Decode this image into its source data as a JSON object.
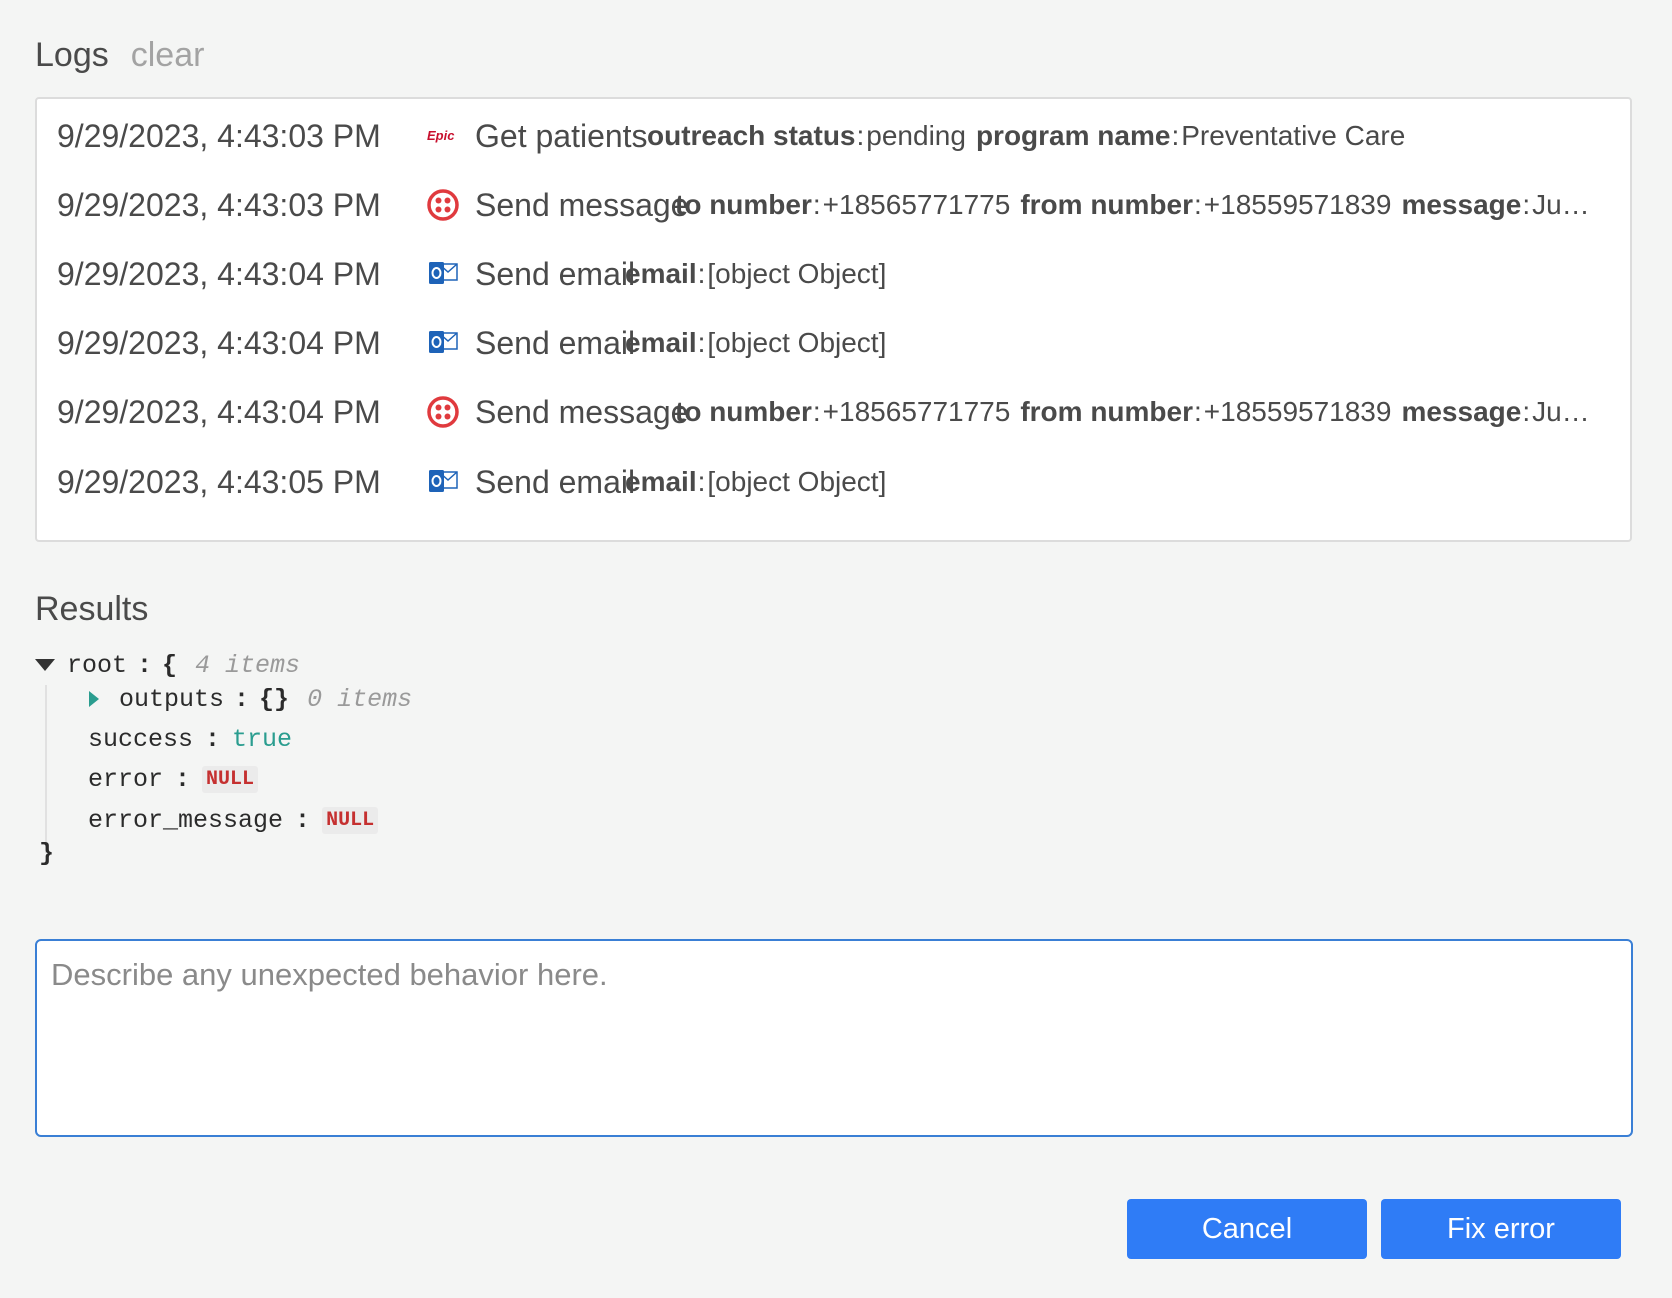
{
  "logs": {
    "title": "Logs",
    "clear_label": "clear",
    "rows": [
      {
        "time": "9/29/2023, 4:43:03 PM",
        "icon": "epic-icon",
        "action": "Get patients",
        "params": [
          {
            "key": "outreach status",
            "value": "pending"
          },
          {
            "key": "program name",
            "value": "Preventative Care"
          }
        ]
      },
      {
        "time": "9/29/2023, 4:43:03 PM",
        "icon": "twilio-icon",
        "action": "Send message",
        "params": [
          {
            "key": "to number",
            "value": "+18565771775"
          },
          {
            "key": "from number",
            "value": "+18559571839"
          },
          {
            "key": "message",
            "value": "Ju…"
          }
        ]
      },
      {
        "time": "9/29/2023, 4:43:04 PM",
        "icon": "outlook-icon",
        "action": "Send email",
        "params": [
          {
            "key": "email",
            "value": "[object Object]"
          }
        ]
      },
      {
        "time": "9/29/2023, 4:43:04 PM",
        "icon": "outlook-icon",
        "action": "Send email",
        "params": [
          {
            "key": "email",
            "value": "[object Object]"
          }
        ]
      },
      {
        "time": "9/29/2023, 4:43:04 PM",
        "icon": "twilio-icon",
        "action": "Send message",
        "params": [
          {
            "key": "to number",
            "value": "+18565771775"
          },
          {
            "key": "from number",
            "value": "+18559571839"
          },
          {
            "key": "message",
            "value": "Ju…"
          }
        ]
      },
      {
        "time": "9/29/2023, 4:43:05 PM",
        "icon": "outlook-icon",
        "action": "Send email",
        "params": [
          {
            "key": "email",
            "value": "[object Object]"
          }
        ]
      }
    ]
  },
  "results": {
    "title": "Results",
    "root_key": "root",
    "root_count": "4 items",
    "outputs_key": "outputs",
    "outputs_value": "{}",
    "outputs_count": "0 items",
    "success_key": "success",
    "success_value": "true",
    "error_key": "error",
    "error_value": "NULL",
    "error_message_key": "error_message",
    "error_message_value": "NULL",
    "open_brace": "{",
    "close_brace": "}",
    "colon": ":"
  },
  "feedback": {
    "placeholder": "Describe any unexpected behavior here.",
    "value": ""
  },
  "buttons": {
    "cancel_label": "Cancel",
    "fix_label": "Fix error"
  },
  "colors": {
    "accent": "#2f7cf6",
    "input_border": "#3a7fd5",
    "json_true": "#2a9d8f",
    "json_null": "#c53030",
    "epic_red": "#c8102e",
    "twilio_red": "#e03a3e",
    "outlook_blue": "#1e63b8"
  }
}
